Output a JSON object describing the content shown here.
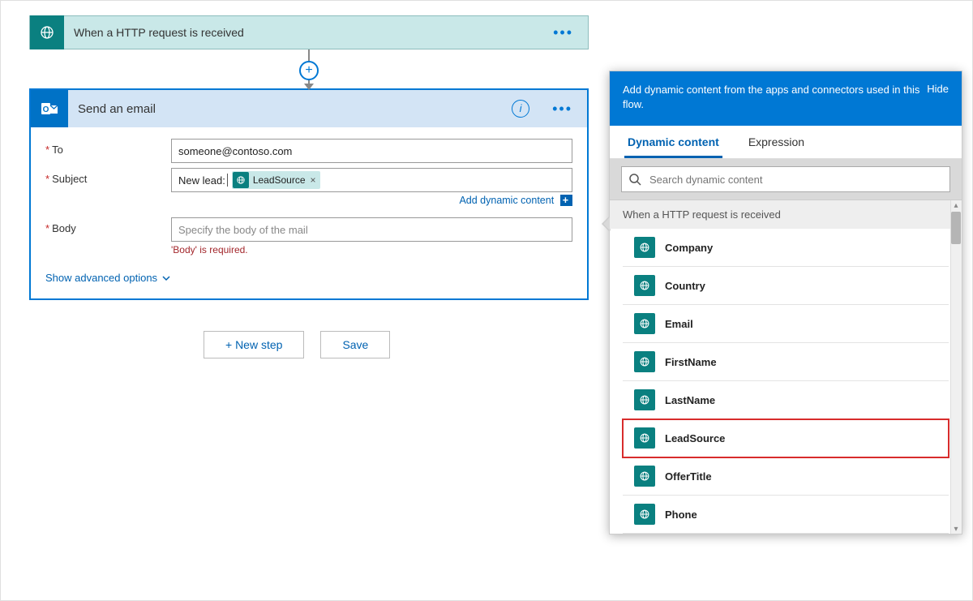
{
  "trigger": {
    "title": "When a HTTP request is received"
  },
  "action": {
    "title": "Send an email",
    "fields": {
      "to_label": "To",
      "to_value": "someone@contoso.com",
      "subject_label": "Subject",
      "subject_prefix": "New lead:",
      "subject_token": "LeadSource",
      "body_label": "Body",
      "body_placeholder": "Specify the body of the mail",
      "body_error": "'Body' is required."
    },
    "add_dc_label": "Add dynamic content",
    "adv_opts": "Show advanced options"
  },
  "buttons": {
    "new_step": "+ New step",
    "save": "Save"
  },
  "dc_panel": {
    "header": "Add dynamic content from the apps and connectors used in this flow.",
    "hide": "Hide",
    "tabs": {
      "dynamic": "Dynamic content",
      "expression": "Expression"
    },
    "search_placeholder": "Search dynamic content",
    "group_title": "When a HTTP request is received",
    "items": [
      "Company",
      "Country",
      "Email",
      "FirstName",
      "LastName",
      "LeadSource",
      "OfferTitle",
      "Phone"
    ],
    "highlighted": "LeadSource"
  }
}
